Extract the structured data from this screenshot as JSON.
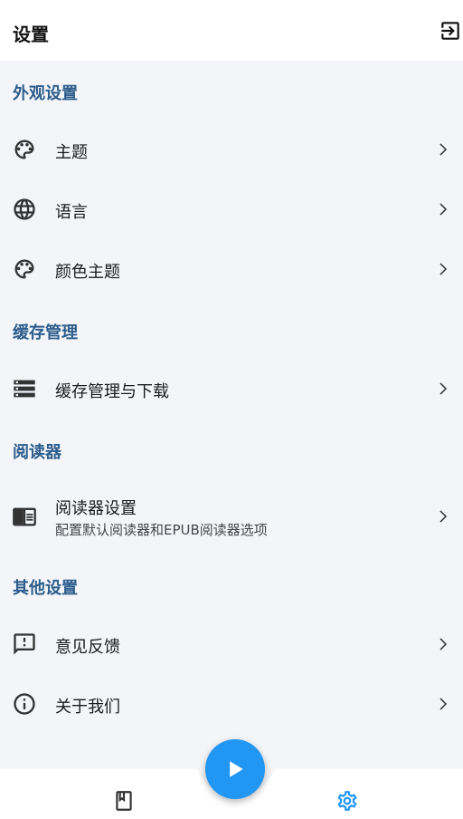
{
  "app_bar": {
    "title": "设置",
    "action_icon": "logout-icon"
  },
  "sections": [
    {
      "header": "外观设置",
      "items": [
        {
          "icon": "palette-icon",
          "title": "主题"
        },
        {
          "icon": "globe-icon",
          "title": "语言"
        },
        {
          "icon": "palette-icon",
          "title": "颜色主题"
        }
      ]
    },
    {
      "header": "缓存管理",
      "items": [
        {
          "icon": "storage-icon",
          "title": "缓存管理与下载"
        }
      ]
    },
    {
      "header": "阅读器",
      "items": [
        {
          "icon": "chrome-reader-icon",
          "title": "阅读器设置",
          "subtitle": "配置默认阅读器和EPUB阅读器选项"
        }
      ]
    },
    {
      "header": "其他设置",
      "items": [
        {
          "icon": "feedback-icon",
          "title": "意见反馈"
        },
        {
          "icon": "info-icon",
          "title": "关于我们"
        }
      ]
    }
  ],
  "bottom_nav": {
    "items": [
      {
        "icon": "book-icon",
        "active": false
      },
      {
        "icon": "settings-gear-icon",
        "active": true
      }
    ],
    "fab_icon": "play-icon"
  },
  "colors": {
    "section_header": "#2d5d8c",
    "accent": "#2196f3",
    "background": "#f3f5f8"
  }
}
